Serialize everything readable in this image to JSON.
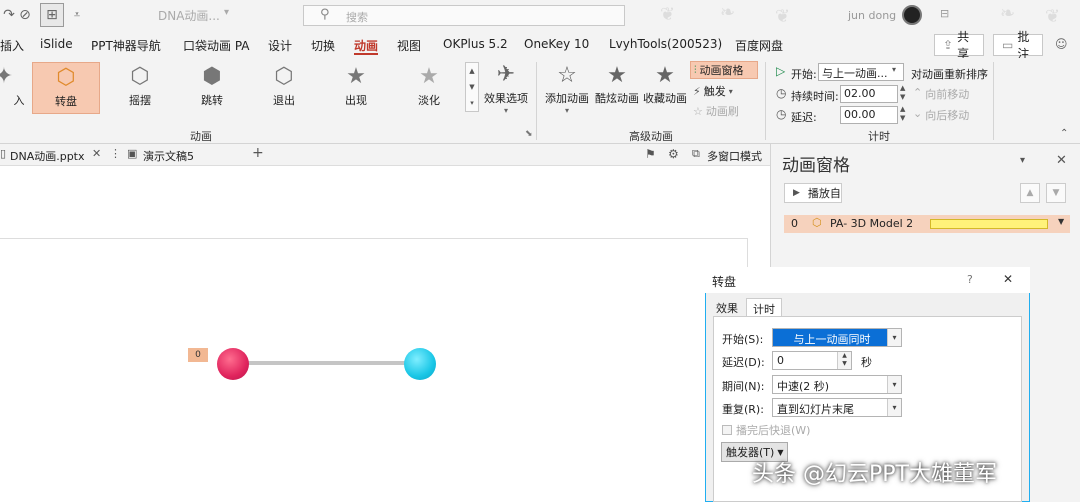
{
  "titlebar": {
    "doc_title": "DNA动画...",
    "search_placeholder": "搜索",
    "user_name": "jun dong"
  },
  "menu_tabs": [
    "插入",
    "iSlide",
    "PPT神器导航",
    "口袋动画 PA",
    "设计",
    "切换",
    "动画",
    "视图",
    "OKPlus 5.2",
    "OneKey 10",
    "LvyhTools(200523)",
    "百度网盘"
  ],
  "top_buttons": {
    "share": "共享",
    "comment": "批注"
  },
  "ribbon": {
    "gallery": [
      "入",
      "转盘",
      "摇摆",
      "跳转",
      "退出",
      "出现",
      "淡化"
    ],
    "effect_options": "效果选项",
    "group_animation": "动画",
    "adv": {
      "add_animation": "添加动画",
      "cool_animation": "酷炫动画",
      "fav_animation": "收藏动画",
      "anim_pane": "动画窗格",
      "trigger": "触发",
      "anim_brush": "动画刷",
      "group_label": "高级动画"
    },
    "timing": {
      "start_label": "开始:",
      "start_value": "与上一动画...",
      "duration_label": "持续时间:",
      "duration_value": "02.00",
      "delay_label": "延迟:",
      "delay_value": "00.00",
      "reorder_label": "对动画重新排序",
      "move_earlier": "向前移动",
      "move_later": "向后移动",
      "group_label": "计时"
    }
  },
  "doc_tabs": {
    "file1": "DNA动画.pptx",
    "file2": "演示文稿5",
    "multiwindow": "多窗口模式"
  },
  "anim_pane": {
    "title": "动画窗格",
    "play_button": "播放自",
    "item": {
      "index": "0",
      "label": "PA- 3D Model 2"
    }
  },
  "slide": {
    "anim_tag": "0"
  },
  "dialog": {
    "title": "转盘",
    "help": "?",
    "tabs": [
      "效果",
      "计时"
    ],
    "fields": {
      "start_label": "开始(S):",
      "start_value": "与上一动画同时",
      "delay_label": "延迟(D):",
      "delay_value": "0",
      "delay_unit": "秒",
      "period_label": "期间(N):",
      "period_value": "中速(2 秒)",
      "repeat_label": "重复(R):",
      "repeat_value": "直到幻灯片末尾",
      "rewind_label": "播完后快退(W)",
      "trigger_button": "触发器(T)"
    }
  },
  "watermark": "头条 @幻云PPT大雄董军"
}
